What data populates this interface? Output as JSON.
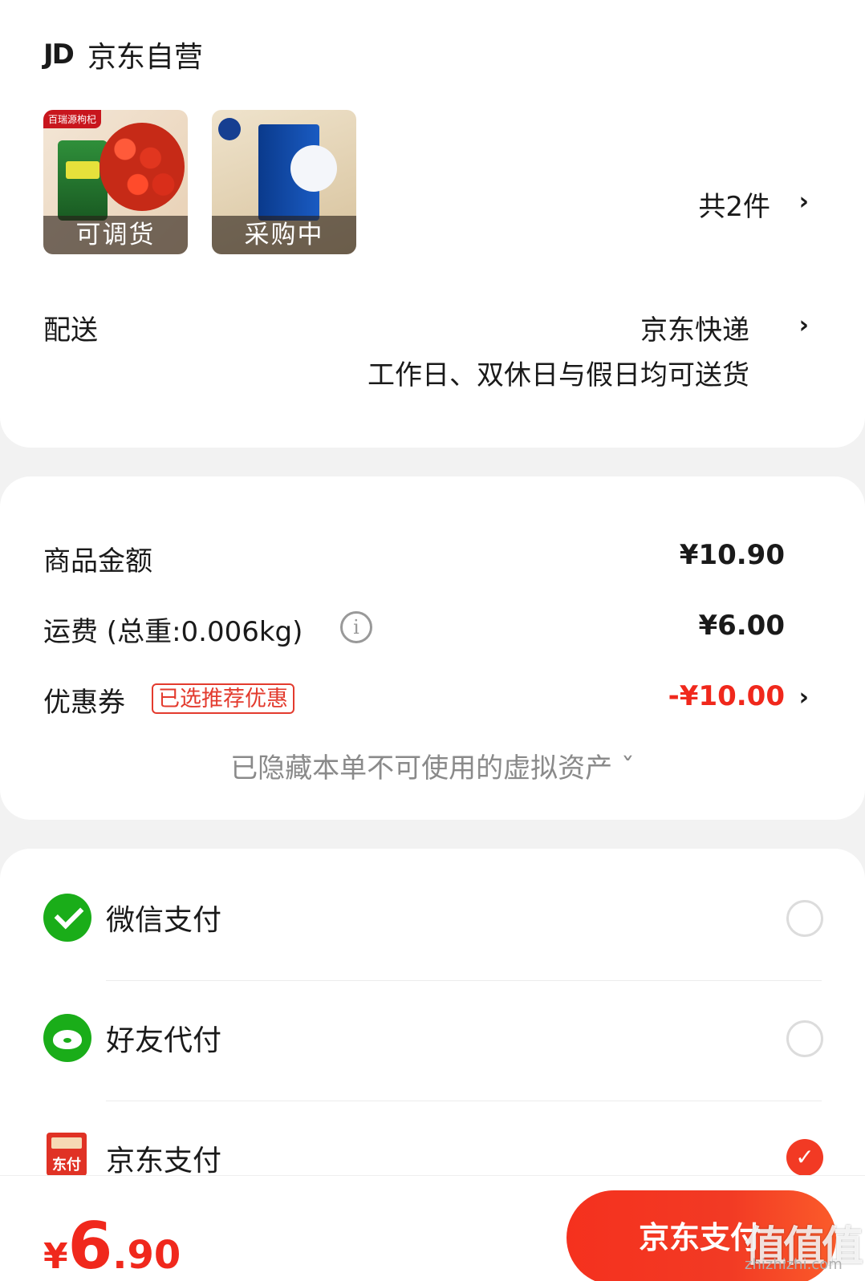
{
  "store": {
    "logo": "JD",
    "name": "京东自营"
  },
  "products": {
    "items": [
      {
        "banner": "百瑞源枸杞",
        "status": "可调货"
      },
      {
        "status": "采购中"
      }
    ],
    "count_label": "共2件"
  },
  "delivery": {
    "label": "配送",
    "method": "京东快递",
    "note": "工作日、双休日与假日均可送货"
  },
  "prices": {
    "goods_label": "商品金额",
    "goods_value": "¥10.90",
    "shipping_label": "运费 (总重:0.006kg)",
    "shipping_value": "¥6.00",
    "coupon_label": "优惠券",
    "coupon_badge": "已选推荐优惠",
    "coupon_value": "-¥10.00",
    "hidden_assets": "已隐藏本单不可使用的虚拟资产 ˇ"
  },
  "payment": {
    "methods": [
      {
        "label": "微信支付",
        "selected": false
      },
      {
        "label": "好友代付",
        "selected": false
      },
      {
        "label": "京东支付",
        "selected": true,
        "icon_text": "东付"
      }
    ]
  },
  "footer": {
    "currency": "¥",
    "total_int": "6",
    "total_dec": ".90",
    "pay_button": "京东支付",
    "watermark": "值值值",
    "watermark_url": "zhizhizhi.com"
  },
  "colors": {
    "accent": "#f0281c",
    "wechat_green": "#1aad19"
  }
}
